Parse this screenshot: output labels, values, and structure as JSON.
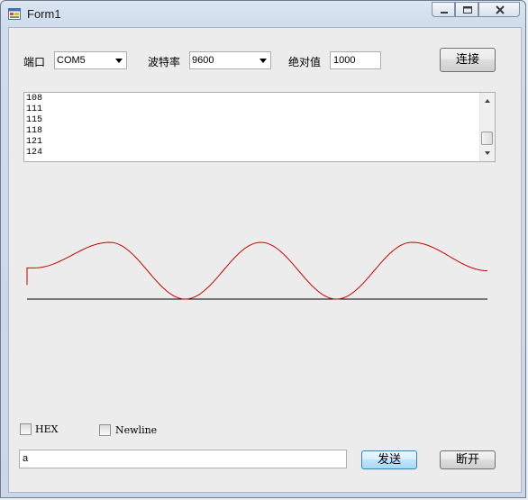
{
  "window": {
    "title": "Form1"
  },
  "controls": {
    "port_label": "端口",
    "port_value": "COM5",
    "baud_label": "波特率",
    "baud_value": "9600",
    "abs_label": "绝对值",
    "abs_value": "1000",
    "connect_button": "连接",
    "send_button": "发送",
    "disconnect_button": "断开",
    "send_input_value": "a"
  },
  "listbox": {
    "lines": [
      "108",
      "111",
      "115",
      "118",
      "121",
      "124"
    ]
  },
  "options": {
    "hex": {
      "label": "HEX",
      "checked": false
    },
    "newline": {
      "label": "Newline",
      "checked": false
    }
  },
  "icons": {
    "app": "form-icon",
    "minimize": "minimize-icon",
    "maximize": "maximize-icon",
    "close": "close-icon",
    "dropdown": "chevron-down-icon"
  },
  "colors": {
    "waveform": "#cc0000",
    "baseline": "#000000"
  },
  "chart_data": {
    "type": "line",
    "series": [
      {
        "x": [
          0,
          1,
          2,
          3,
          4,
          5,
          6
        ],
        "values": [
          0.55,
          1.0,
          0.0,
          1.0,
          0.0,
          1.0,
          0.5
        ]
      }
    ]
  }
}
